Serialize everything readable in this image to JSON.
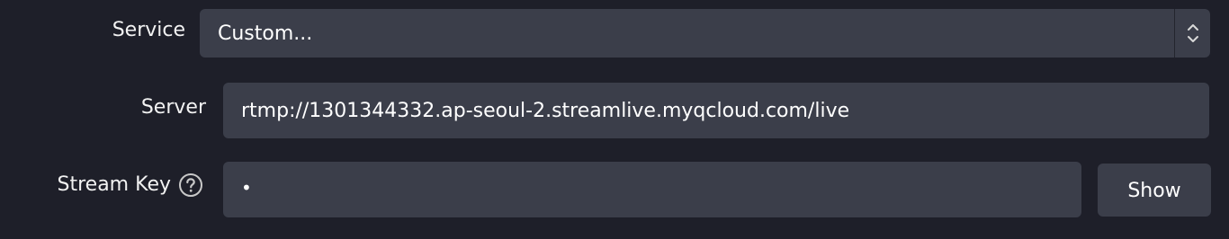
{
  "service": {
    "label": "Service",
    "selected_value": "Custom..."
  },
  "server": {
    "label": "Server",
    "value": "rtmp://1301344332.ap-seoul-2.streamlive.myqcloud.com/live"
  },
  "stream_key": {
    "label": "Stream Key",
    "value": "•",
    "help_icon": "question-circle-icon",
    "show_label": "Show"
  },
  "colors": {
    "background": "#1e1f29",
    "field_background": "#3b3e4a",
    "text": "#ffffff"
  }
}
